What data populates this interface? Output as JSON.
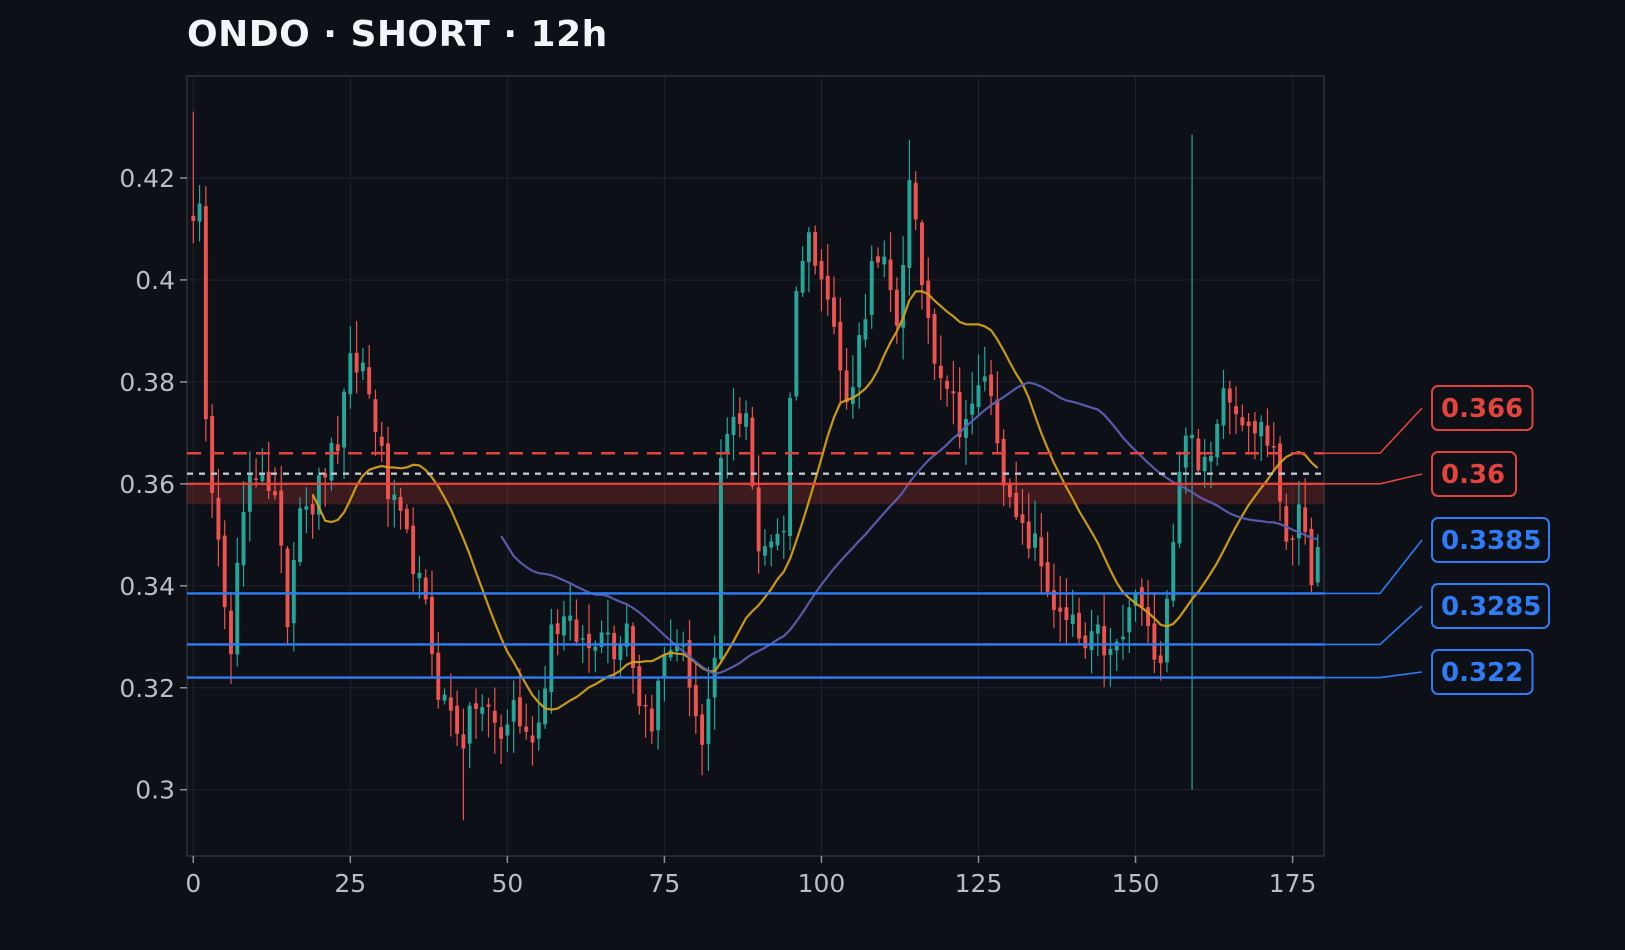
{
  "title": "ONDO · SHORT · 12h",
  "colors": {
    "background": "#0d1017",
    "grid": "#1e232c",
    "axis_text": "#b8bdc7",
    "up_candle": "#26a69a",
    "down_candle": "#ef5350",
    "ma_fast": "#d4a017",
    "ma_slow": "#5c5fb0",
    "stop_zone": "#e0443c",
    "entry_line": "#bfc4cc",
    "target_line": "#2f7df6"
  },
  "chart_data": {
    "type": "candlestick",
    "title": "ONDO · SHORT · 12h",
    "xlim": [
      -1,
      180
    ],
    "ylim": [
      0.287,
      0.44
    ],
    "x_ticks": [
      0,
      25,
      50,
      75,
      100,
      125,
      150,
      175
    ],
    "y_ticks": [
      0.3,
      0.32,
      0.34,
      0.36,
      0.38,
      0.4,
      0.42
    ],
    "y_tick_labels": [
      "0.3",
      "0.32",
      "0.34",
      "0.36",
      "0.38",
      "0.4",
      "0.42"
    ],
    "grid": true,
    "anchors": [
      [
        0,
        0.414
      ],
      [
        1,
        0.413
      ],
      [
        2,
        0.37
      ],
      [
        4,
        0.352
      ],
      [
        6,
        0.325
      ],
      [
        7,
        0.344
      ],
      [
        9,
        0.36
      ],
      [
        11,
        0.364
      ],
      [
        13,
        0.356
      ],
      [
        15,
        0.334
      ],
      [
        17,
        0.358
      ],
      [
        19,
        0.356
      ],
      [
        21,
        0.363
      ],
      [
        23,
        0.368
      ],
      [
        25,
        0.383
      ],
      [
        27,
        0.383
      ],
      [
        29,
        0.372
      ],
      [
        31,
        0.358
      ],
      [
        33,
        0.352
      ],
      [
        35,
        0.345
      ],
      [
        37,
        0.335
      ],
      [
        39,
        0.32
      ],
      [
        41,
        0.315
      ],
      [
        43,
        0.31
      ],
      [
        45,
        0.317
      ],
      [
        47,
        0.315
      ],
      [
        49,
        0.31
      ],
      [
        51,
        0.317
      ],
      [
        53,
        0.31
      ],
      [
        55,
        0.313
      ],
      [
        57,
        0.332
      ],
      [
        59,
        0.333
      ],
      [
        61,
        0.33
      ],
      [
        63,
        0.328
      ],
      [
        65,
        0.333
      ],
      [
        67,
        0.328
      ],
      [
        69,
        0.333
      ],
      [
        71,
        0.318
      ],
      [
        73,
        0.314
      ],
      [
        75,
        0.326
      ],
      [
        77,
        0.33
      ],
      [
        79,
        0.322
      ],
      [
        81,
        0.308
      ],
      [
        83,
        0.323
      ],
      [
        84,
        0.365
      ],
      [
        86,
        0.372
      ],
      [
        88,
        0.375
      ],
      [
        90,
        0.345
      ],
      [
        92,
        0.35
      ],
      [
        94,
        0.352
      ],
      [
        96,
        0.4
      ],
      [
        98,
        0.408
      ],
      [
        100,
        0.403
      ],
      [
        102,
        0.39
      ],
      [
        104,
        0.375
      ],
      [
        106,
        0.388
      ],
      [
        108,
        0.402
      ],
      [
        110,
        0.402
      ],
      [
        112,
        0.392
      ],
      [
        114,
        0.418
      ],
      [
        116,
        0.4
      ],
      [
        118,
        0.386
      ],
      [
        120,
        0.38
      ],
      [
        122,
        0.372
      ],
      [
        124,
        0.374
      ],
      [
        126,
        0.382
      ],
      [
        128,
        0.37
      ],
      [
        130,
        0.355
      ],
      [
        132,
        0.35
      ],
      [
        134,
        0.348
      ],
      [
        136,
        0.34
      ],
      [
        138,
        0.333
      ],
      [
        140,
        0.332
      ],
      [
        142,
        0.327
      ],
      [
        144,
        0.33
      ],
      [
        146,
        0.326
      ],
      [
        148,
        0.33
      ],
      [
        150,
        0.339
      ],
      [
        152,
        0.33
      ],
      [
        154,
        0.327
      ],
      [
        156,
        0.35
      ],
      [
        158,
        0.372
      ],
      [
        160,
        0.362
      ],
      [
        162,
        0.368
      ],
      [
        164,
        0.38
      ],
      [
        166,
        0.376
      ],
      [
        168,
        0.37
      ],
      [
        170,
        0.372
      ],
      [
        172,
        0.365
      ],
      [
        174,
        0.35
      ],
      [
        176,
        0.353
      ],
      [
        178,
        0.343
      ],
      [
        179,
        0.346
      ]
    ],
    "overlays": [
      {
        "name": "ma_fast",
        "period": 20
      },
      {
        "name": "ma_slow",
        "period": 50
      }
    ],
    "levels": [
      {
        "value": 0.366,
        "label": "0.366",
        "style": "dashed",
        "color": "#e0443c",
        "labeled": true
      },
      {
        "value": 0.362,
        "label": "",
        "style": "dotted",
        "color": "#bfc4cc",
        "labeled": false
      },
      {
        "value": 0.36,
        "label": "0.36",
        "style": "solid",
        "color": "#e0443c",
        "labeled": true
      },
      {
        "value": 0.3385,
        "label": "0.3385",
        "style": "solid",
        "color": "#2f7df6",
        "labeled": true
      },
      {
        "value": 0.3285,
        "label": "0.3285",
        "style": "solid",
        "color": "#2f7df6",
        "labeled": true
      },
      {
        "value": 0.322,
        "label": "0.322",
        "style": "solid",
        "color": "#2f7df6",
        "labeled": true
      }
    ],
    "zone": {
      "from": 0.356,
      "to": 0.36
    }
  }
}
